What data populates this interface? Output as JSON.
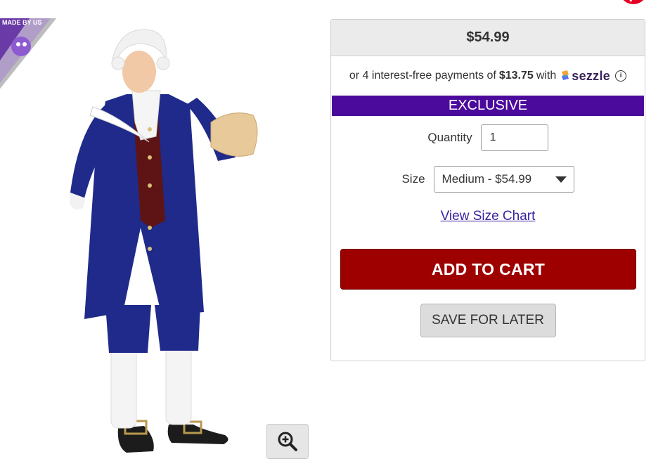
{
  "social": {
    "icons": [
      "twitter-icon",
      "pinterest-icon"
    ]
  },
  "badge": {
    "text": "MADE BY US"
  },
  "panel": {
    "price": "$54.99",
    "sezzle": {
      "prefix": "or 4 interest-free payments of",
      "amount": "$13.75",
      "with": "with",
      "brand": "sezzle",
      "info": "i"
    },
    "exclusive": "EXCLUSIVE",
    "quantity": {
      "label": "Quantity",
      "value": "1"
    },
    "size": {
      "label": "Size",
      "selected": "Medium - $54.99"
    },
    "size_chart_link": "View Size Chart",
    "add_to_cart": "ADD TO CART",
    "save_for_later": "SAVE FOR LATER"
  },
  "colors": {
    "exclusive_bg": "#4b0a9c",
    "add_to_cart_bg": "#9e0000",
    "costume_coat": "#1f2a8a",
    "link": "#3a1fa0"
  }
}
